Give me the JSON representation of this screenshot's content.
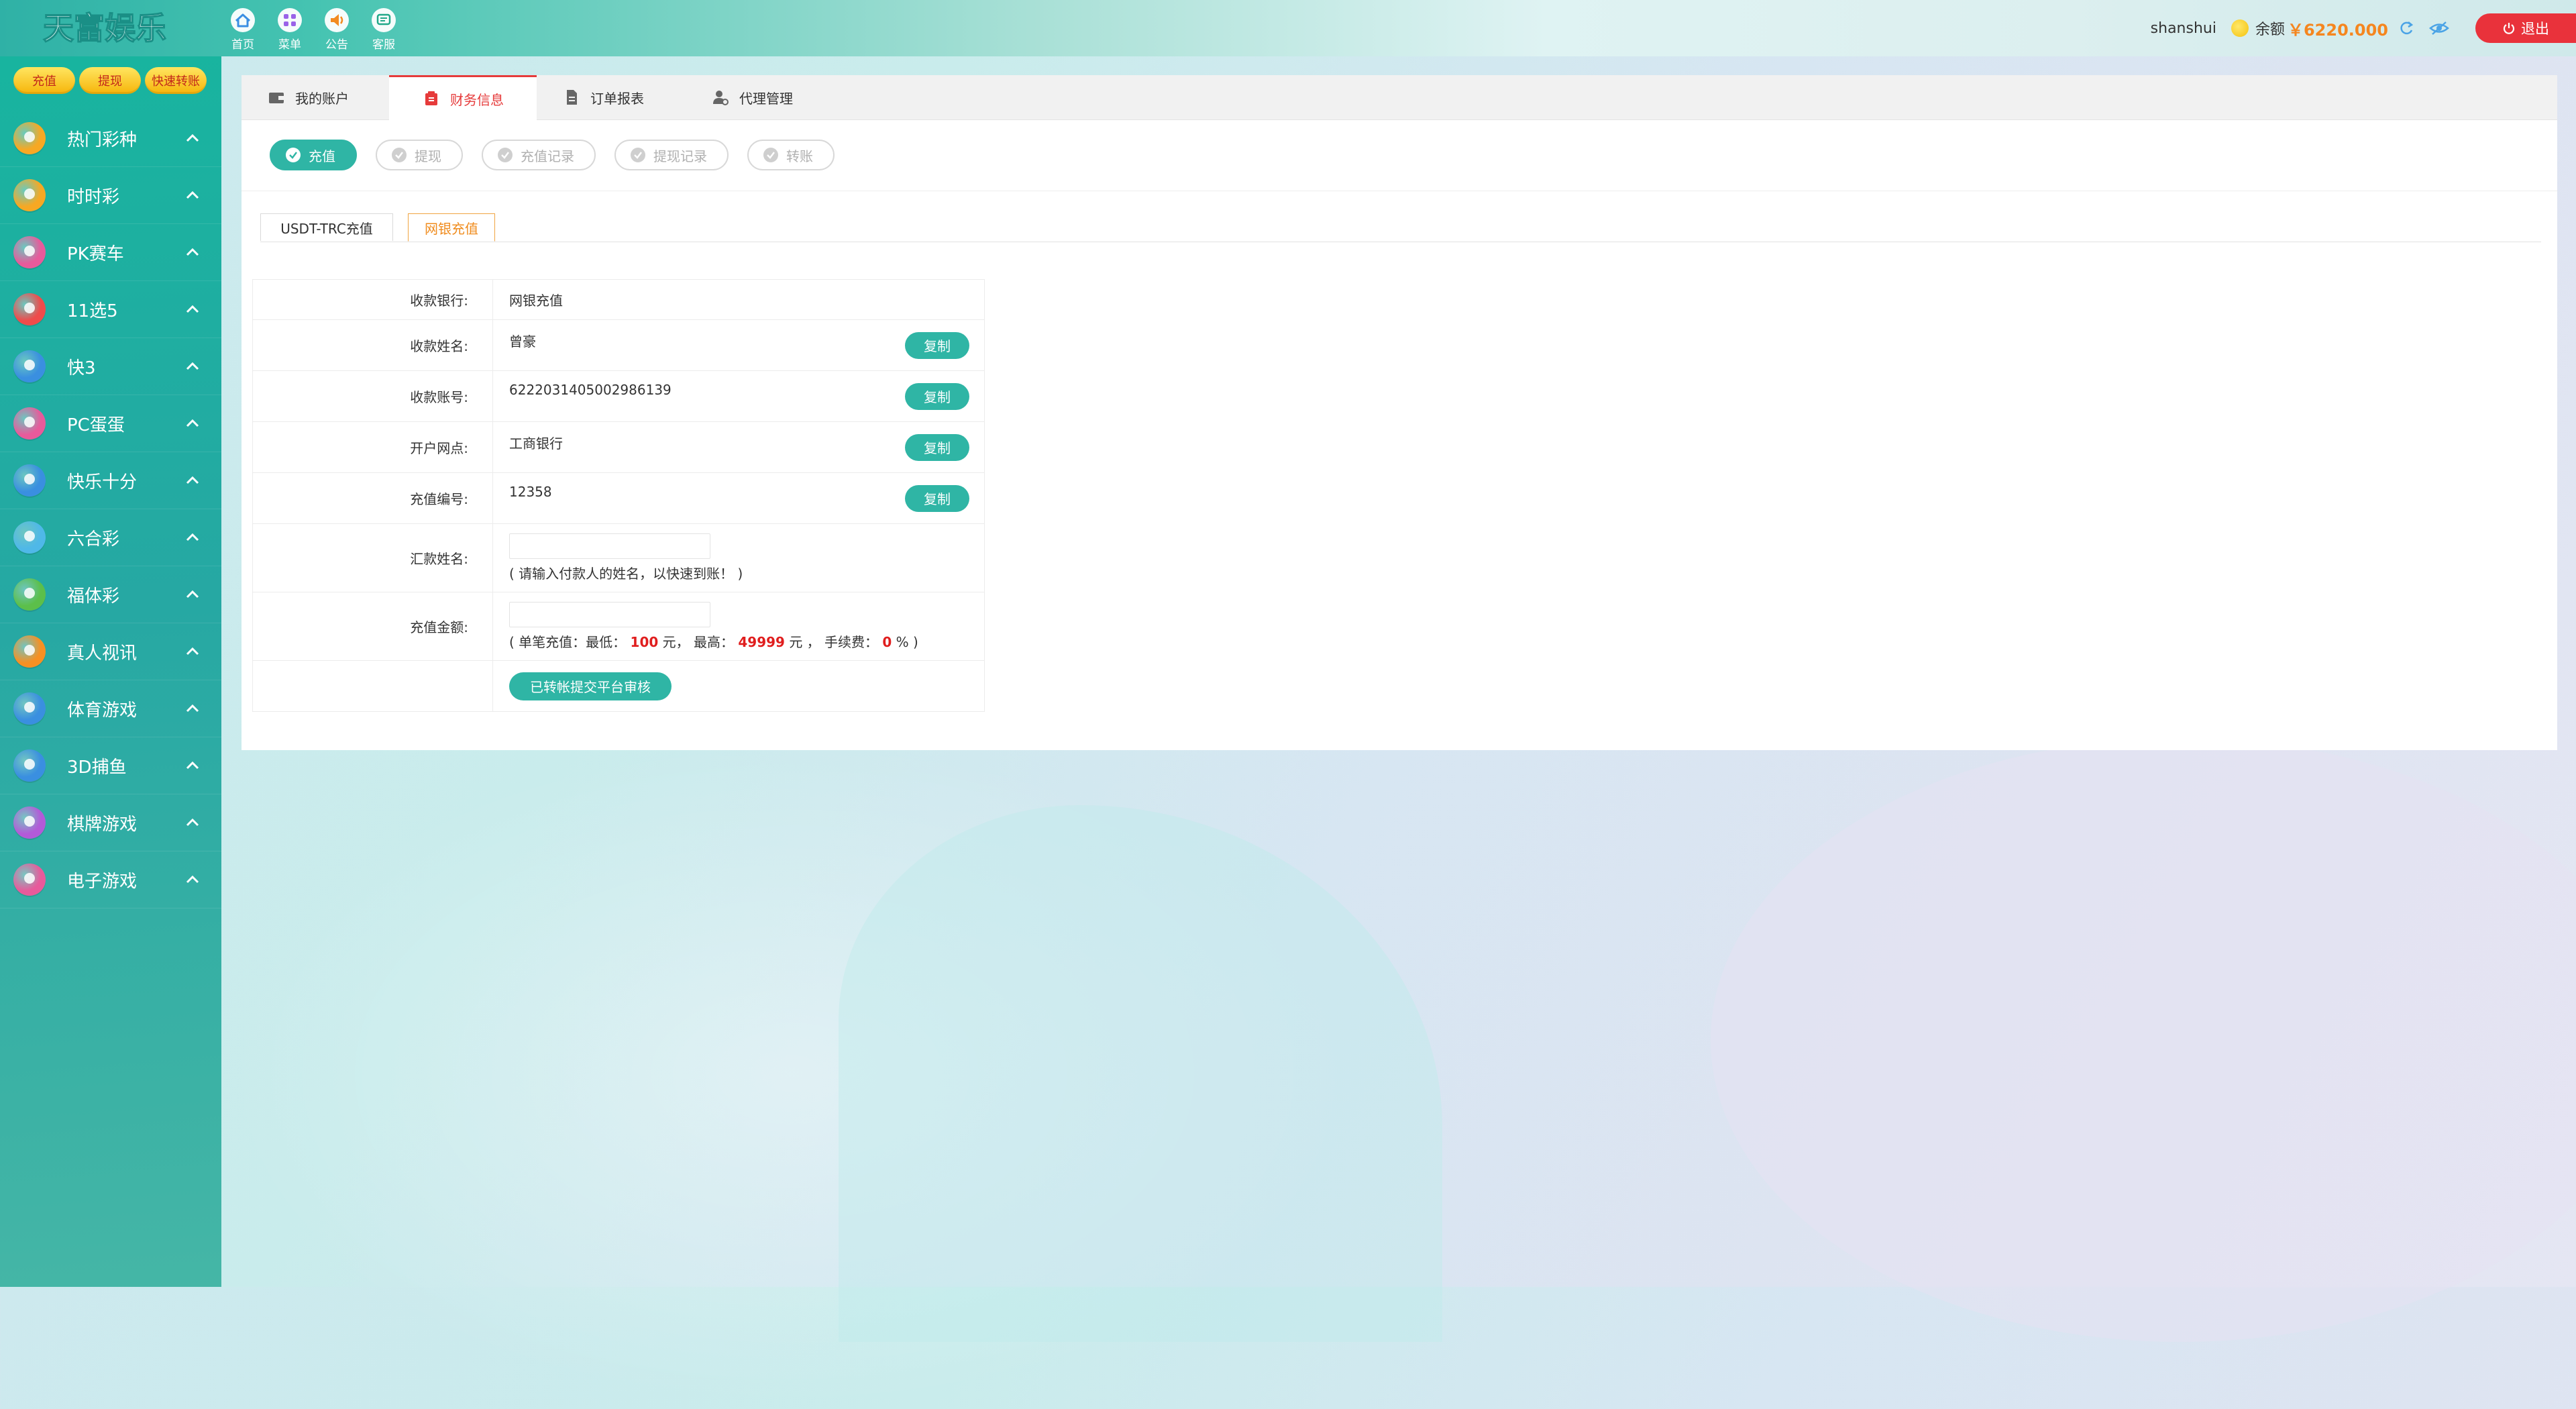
{
  "app": {
    "logo_text": "天富娱乐"
  },
  "topnav": [
    {
      "label": "首页",
      "icon": "home-icon"
    },
    {
      "label": "菜单",
      "icon": "grid-menu-icon"
    },
    {
      "label": "公告",
      "icon": "speaker-icon"
    },
    {
      "label": "客服",
      "icon": "chat-icon"
    }
  ],
  "user": {
    "name": "shanshui",
    "balance_label": "余额",
    "balance": "￥6220.000",
    "logout_label": "退出"
  },
  "quick_actions": [
    "充值",
    "提现",
    "快速转账"
  ],
  "categories": [
    {
      "label": "热门彩种",
      "color": "#f7a823"
    },
    {
      "label": "时时彩",
      "color": "#f7a823"
    },
    {
      "label": "PK赛车",
      "color": "#e85a9b"
    },
    {
      "label": "11选5",
      "color": "#ef4b4b"
    },
    {
      "label": "快3",
      "color": "#3a8fe0"
    },
    {
      "label": "PC蛋蛋",
      "color": "#e85a9b"
    },
    {
      "label": "快乐十分",
      "color": "#3a8fe0"
    },
    {
      "label": "六合彩",
      "color": "#4fb8e8"
    },
    {
      "label": "福体彩",
      "color": "#5cbf4a"
    },
    {
      "label": "真人视讯",
      "color": "#f79023"
    },
    {
      "label": "体育游戏",
      "color": "#3a8fe0"
    },
    {
      "label": "3D捕鱼",
      "color": "#3a8fe0"
    },
    {
      "label": "棋牌游戏",
      "color": "#b35ad8"
    },
    {
      "label": "电子游戏",
      "color": "#e85a9b"
    }
  ],
  "tabs": [
    {
      "label": "我的账户",
      "icon": "wallet-icon"
    },
    {
      "label": "财务信息",
      "icon": "finance-icon"
    },
    {
      "label": "订单报表",
      "icon": "document-icon"
    },
    {
      "label": "代理管理",
      "icon": "agent-icon"
    }
  ],
  "subtabs": [
    "充值",
    "提现",
    "充值记录",
    "提现记录",
    "转账"
  ],
  "methods": [
    "USDT-TRC充值",
    "网银充值"
  ],
  "form": {
    "bank_label": "收款银行:",
    "bank_value": "网银充值",
    "name_label": "收款姓名:",
    "name_value": "曾豪",
    "account_label": "收款账号:",
    "account_value": "6222031405002986139",
    "branch_label": "开户网点:",
    "branch_value": "工商银行",
    "code_label": "充值编号:",
    "code_value": "12358",
    "payer_label": "汇款姓名:",
    "payer_hint": "( 请输入付款人的姓名，以快速到账！ )",
    "amount_label": "充值金额:",
    "amount_hint_prefix": "( 单笔充值：最低：",
    "min": "100",
    "amount_hint_mid1": "元， 最高：",
    "max": "49999",
    "amount_hint_mid2": "元 ， 手续费：",
    "fee": "0",
    "amount_hint_suffix": "% )",
    "copy_label": "复制",
    "submit_label": "已转帐提交平台审核"
  },
  "colors": {
    "accent": "#2fb5a5",
    "active_tab": "#e63b3b",
    "balance": "#f5861f",
    "logout": "#e9323b",
    "method_active": "#f08c1e"
  }
}
